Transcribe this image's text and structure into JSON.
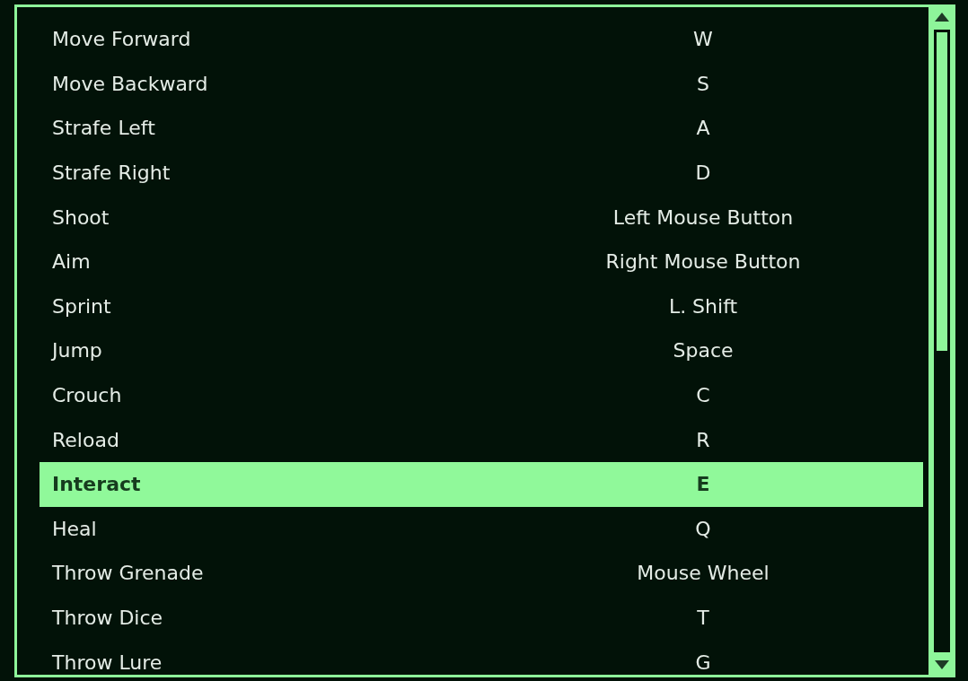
{
  "bindings": [
    {
      "action": "Move Forward",
      "key": "W",
      "selected": false
    },
    {
      "action": "Move Backward",
      "key": "S",
      "selected": false
    },
    {
      "action": "Strafe Left",
      "key": "A",
      "selected": false
    },
    {
      "action": "Strafe Right",
      "key": "D",
      "selected": false
    },
    {
      "action": "Shoot",
      "key": "Left Mouse Button",
      "selected": false
    },
    {
      "action": "Aim",
      "key": "Right Mouse Button",
      "selected": false
    },
    {
      "action": "Sprint",
      "key": "L. Shift",
      "selected": false
    },
    {
      "action": "Jump",
      "key": "Space",
      "selected": false
    },
    {
      "action": "Crouch",
      "key": "C",
      "selected": false
    },
    {
      "action": "Reload",
      "key": "R",
      "selected": false
    },
    {
      "action": "Interact",
      "key": "E",
      "selected": true
    },
    {
      "action": "Heal",
      "key": "Q",
      "selected": false
    },
    {
      "action": "Throw Grenade",
      "key": "Mouse Wheel",
      "selected": false
    },
    {
      "action": "Throw Dice",
      "key": "T",
      "selected": false
    },
    {
      "action": "Throw Lure",
      "key": "G",
      "selected": false
    }
  ]
}
